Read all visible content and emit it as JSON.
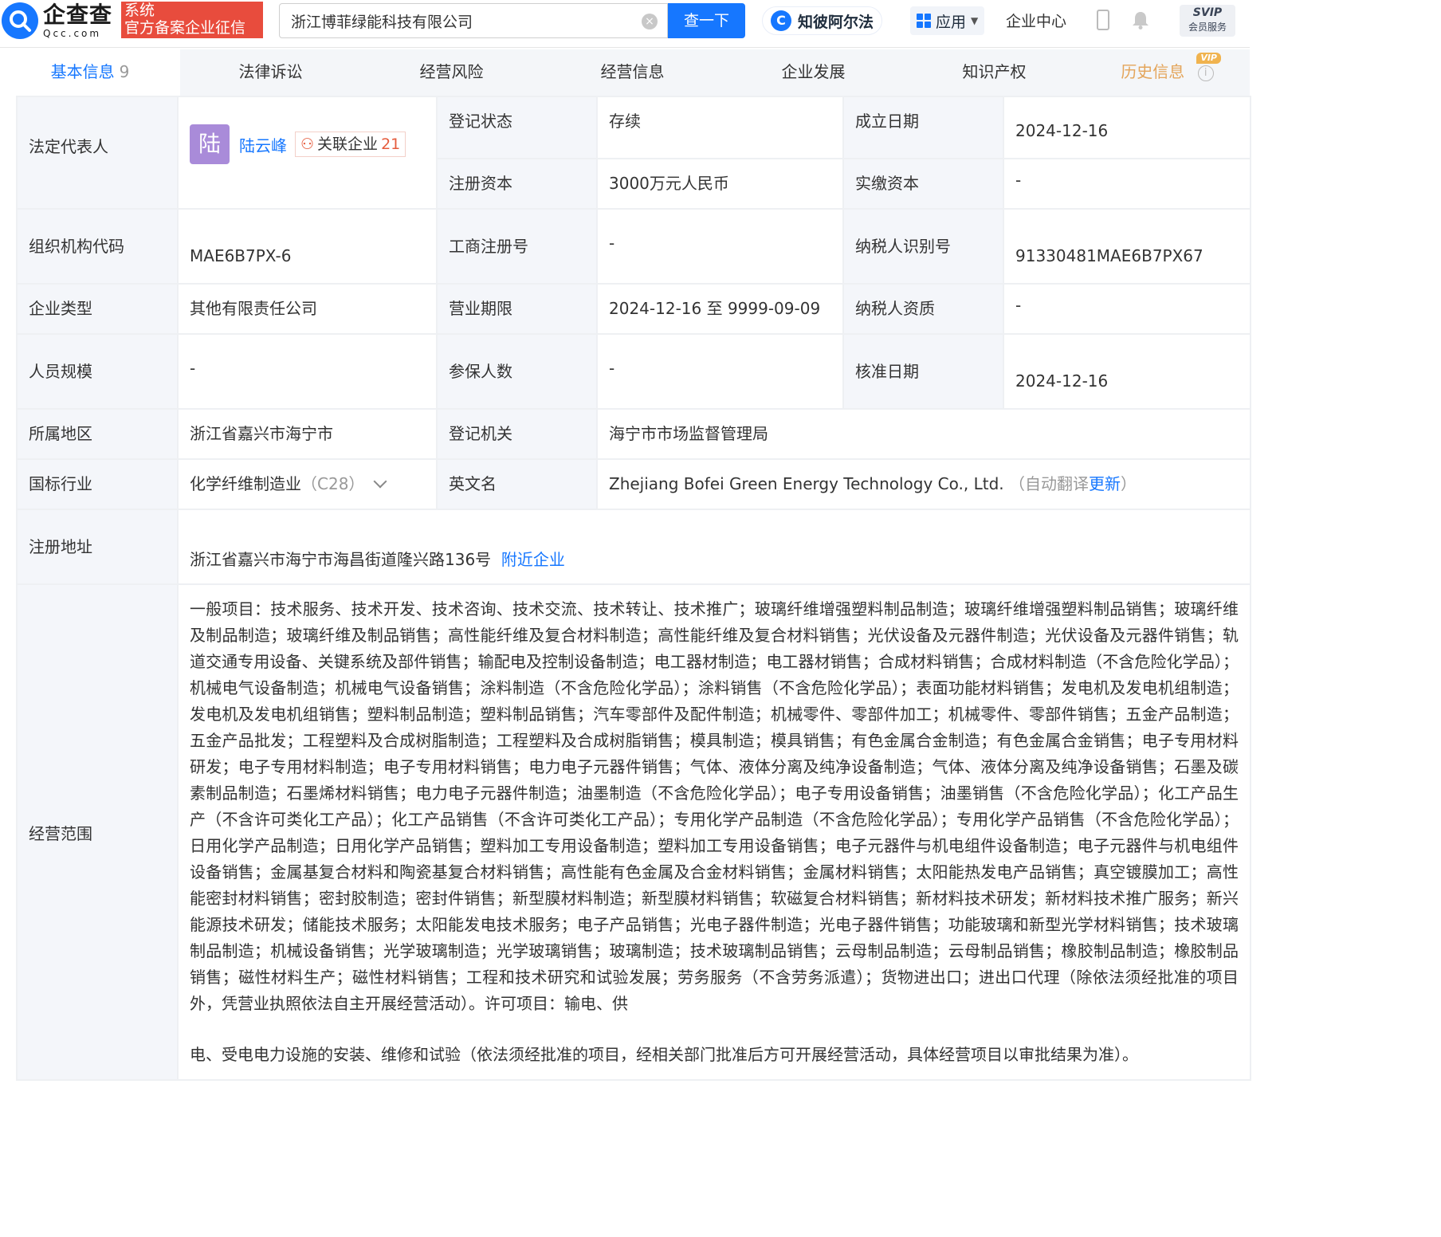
{
  "header": {
    "logo_cn": "企查查",
    "logo_en": "Qcc.com",
    "badge_line1": "系统",
    "badge_line2": "官方备案企业征信",
    "search_value": "浙江博菲绿能科技有限公司",
    "search_button": "查一下",
    "ai_label": "知彼阿尔法",
    "app_label": "应用",
    "center_label": "企业中心",
    "svip_line1": "SVIP",
    "svip_line2": "会员服务"
  },
  "tabs": [
    {
      "label": "基本信息",
      "count": "9"
    },
    {
      "label": "法律诉讼"
    },
    {
      "label": "经营风险"
    },
    {
      "label": "经营信息"
    },
    {
      "label": "企业发展"
    },
    {
      "label": "知识产权"
    },
    {
      "label": "历史信息",
      "badge": "VIP"
    }
  ],
  "info": {
    "legal_rep_label": "法定代表人",
    "legal_rep_avatar": "陆",
    "legal_rep_name": "陆云峰",
    "related_label": "关联企业",
    "related_count": "21",
    "reg_status_label": "登记状态",
    "reg_status": "存续",
    "founded_label": "成立日期",
    "founded": "2024-12-16",
    "reg_capital_label": "注册资本",
    "reg_capital": "3000万元人民币",
    "paid_capital_label": "实缴资本",
    "paid_capital": "-",
    "org_code_label": "组织机构代码",
    "org_code": "MAE6B7PX-6",
    "biz_reg_no_label": "工商注册号",
    "biz_reg_no": "-",
    "taxpayer_id_label": "纳税人识别号",
    "taxpayer_id": "91330481MAE6B7PX67",
    "company_type_label": "企业类型",
    "company_type": "其他有限责任公司",
    "term_label": "营业期限",
    "term": "2024-12-16 至 9999-09-09",
    "taxpayer_qual_label": "纳税人资质",
    "taxpayer_qual": "-",
    "staff_label": "人员规模",
    "staff": "-",
    "insured_label": "参保人数",
    "insured": "-",
    "approved_label": "核准日期",
    "approved": "2024-12-16",
    "region_label": "所属地区",
    "region": "浙江省嘉兴市海宁市",
    "authority_label": "登记机关",
    "authority": "海宁市市场监督管理局",
    "industry_label": "国标行业",
    "industry": "化学纤维制造业",
    "industry_code": "（C28）",
    "en_name_label": "英文名",
    "en_name": "Zhejiang Bofei Green Energy Technology Co., Ltd.",
    "en_auto": "（自动翻译",
    "en_update": "更新",
    "en_close": "）",
    "address_label": "注册地址",
    "address": "浙江省嘉兴市海宁市海昌街道隆兴路136号",
    "nearby": "附近企业",
    "scope_label": "经营范围",
    "scope_main": "一般项目：技术服务、技术开发、技术咨询、技术交流、技术转让、技术推广；玻璃纤维增强塑料制品制造；玻璃纤维增强塑料制品销售；玻璃纤维及制品制造；玻璃纤维及制品销售；高性能纤维及复合材料制造；高性能纤维及复合材料销售；光伏设备及元器件制造；光伏设备及元器件销售；轨道交通专用设备、关键系统及部件销售；输配电及控制设备制造；电工器材制造；电工器材销售；合成材料销售；合成材料制造（不含危险化学品）；机械电气设备制造；机械电气设备销售；涂料制造（不含危险化学品）；涂料销售（不含危险化学品）；表面功能材料销售；发电机及发电机组制造；发电机及发电机组销售；塑料制品制造；塑料制品销售；汽车零部件及配件制造；机械零件、零部件加工；机械零件、零部件销售；五金产品制造；五金产品批发；工程塑料及合成树脂制造；工程塑料及合成树脂销售；模具制造；模具销售；有色金属合金制造；有色金属合金销售；电子专用材料研发；电子专用材料制造；电子专用材料销售；电力电子元器件销售；气体、液体分离及纯净设备制造；气体、液体分离及纯净设备销售；石墨及碳素制品制造；石墨烯材料销售；电力电子元器件制造；油墨制造（不含危险化学品）；电子专用设备销售；油墨销售（不含危险化学品）；化工产品生产（不含许可类化工产品）；化工产品销售（不含许可类化工产品）；专用化学产品制造（不含危险化学品）；专用化学产品销售（不含危险化学品）；日用化学产品制造；日用化学产品销售；塑料加工专用设备制造；塑料加工专用设备销售；电子元器件与机电组件设备制造；电子元器件与机电组件设备销售；金属基复合材料和陶瓷基复合材料销售；高性能有色金属及合金材料销售；金属材料销售；太阳能热发电产品销售；真空镀膜加工；高性能密封材料销售；密封胶制造；密封件销售；新型膜材料制造；新型膜材料销售；软磁复合材料销售；新材料技术研发；新材料技术推广服务；新兴能源技术研发；储能技术服务；太阳能发电技术服务；电子产品销售；光电子器件制造；光电子器件销售；功能玻璃和新型光学材料销售；技术玻璃制品制造；机械设备销售；光学玻璃制造；光学玻璃销售；玻璃制造；技术玻璃制品销售；云母制品制造；云母制品销售；橡胶制品制造；橡胶制品销售；磁性材料生产；磁性材料销售；工程和技术研究和试验发展；劳务服务（不含劳务派遣）；货物进出口；进出口代理（除依法须经批准的项目外，凭营业执照依法自主开展经营活动）。许可项目：输电、供",
    "scope_tail": "电、受电电力设施的安装、维修和试验（依法须经批准的项目，经相关部门批准后方可开展经营活动，具体经营项目以审批结果为准）。"
  },
  "colors": {
    "accent": "#1677ff",
    "badge_red": "#e84c3d",
    "label_bg": "#f4f6fa",
    "history_gold": "#e4a55b"
  }
}
